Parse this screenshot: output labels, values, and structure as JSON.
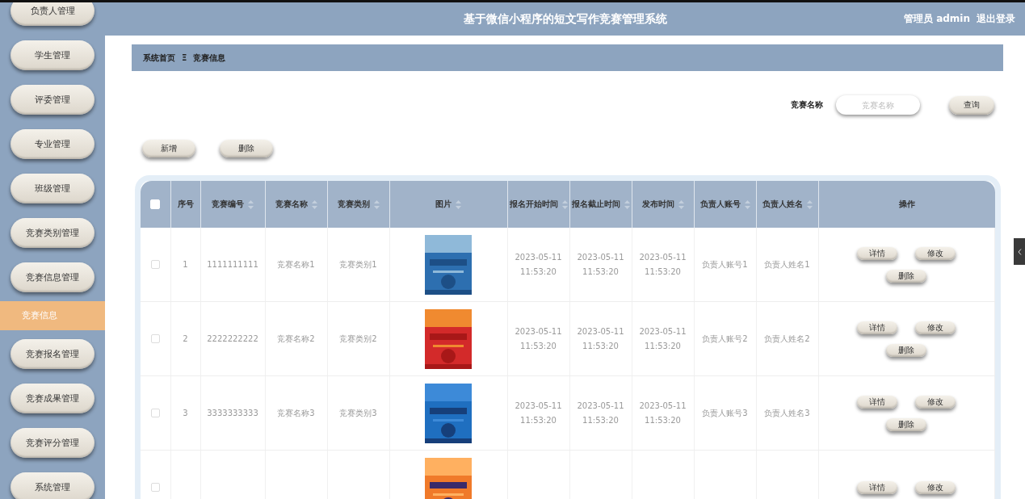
{
  "header": {
    "title": "基于微信小程序的短文写作竞赛管理系统",
    "user": "管理员 admin",
    "logout": "退出登录"
  },
  "sidebar": {
    "items": [
      {
        "label": "负责人管理",
        "selected": false
      },
      {
        "label": "学生管理",
        "selected": false
      },
      {
        "label": "评委管理",
        "selected": false
      },
      {
        "label": "专业管理",
        "selected": false
      },
      {
        "label": "班级管理",
        "selected": false
      },
      {
        "label": "竞赛类别管理",
        "selected": false
      },
      {
        "label": "竞赛信息管理",
        "selected": false
      },
      {
        "label": "竞赛信息",
        "selected": true
      },
      {
        "label": "竞赛报名管理",
        "selected": false
      },
      {
        "label": "竞赛成果管理",
        "selected": false
      },
      {
        "label": "竞赛评分管理",
        "selected": false
      },
      {
        "label": "系统管理",
        "selected": false
      }
    ]
  },
  "breadcrumb": {
    "home": "系统首页",
    "separator": "Ξ",
    "current": "竞赛信息"
  },
  "search": {
    "label": "竞赛名称",
    "placeholder": "竞赛名称",
    "button": "查询"
  },
  "actions": [
    "新增",
    "删除"
  ],
  "table": {
    "select_all_checked": false,
    "columns": [
      {
        "label": "序号",
        "sortable": false
      },
      {
        "label": "竞赛编号",
        "sortable": true
      },
      {
        "label": "竞赛名称",
        "sortable": true
      },
      {
        "label": "竞赛类别",
        "sortable": true
      },
      {
        "label": "图片",
        "sortable": true
      },
      {
        "label": "报名开始时间",
        "sortable": true
      },
      {
        "label": "报名截止时间",
        "sortable": true
      },
      {
        "label": "发布时间",
        "sortable": true
      },
      {
        "label": "负责人账号",
        "sortable": true
      },
      {
        "label": "负责人姓名",
        "sortable": true
      },
      {
        "label": "操作",
        "sortable": false
      }
    ],
    "rows": [
      {
        "checked": false,
        "cells": [
          "1",
          "1111111111",
          "竞赛名称1",
          "竞赛类别1",
          {
            "kind": "picture"
          },
          "2023-05-11 11:53:20",
          "2023-05-11 11:53:20",
          "2023-05-11 11:53:20",
          "负责人账号1",
          "负责人姓名1"
        ],
        "buttons": [
          "详情",
          "修改",
          "删除"
        ]
      },
      {
        "checked": false,
        "cells": [
          "2",
          "2222222222",
          "竞赛名称2",
          "竞赛类别2",
          {
            "kind": "picture"
          },
          "2023-05-11 11:53:20",
          "2023-05-11 11:53:20",
          "2023-05-11 11:53:20",
          "负责人账号2",
          "负责人姓名2"
        ],
        "buttons": [
          "详情",
          "修改",
          "删除"
        ]
      },
      {
        "checked": false,
        "cells": [
          "3",
          "3333333333",
          "竞赛名称3",
          "竞赛类别3",
          {
            "kind": "picture"
          },
          "2023-05-11 11:53:20",
          "2023-05-11 11:53:20",
          "2023-05-11 11:53:20",
          "负责人账号3",
          "负责人姓名3"
        ],
        "buttons": [
          "详情",
          "修改",
          "删除"
        ]
      },
      {
        "checked": false,
        "cells": [
          "",
          "",
          "",
          "",
          {
            "kind": "picture"
          },
          "",
          "",
          "",
          "",
          ""
        ],
        "buttons": [
          "详情",
          "修改"
        ]
      }
    ]
  }
}
